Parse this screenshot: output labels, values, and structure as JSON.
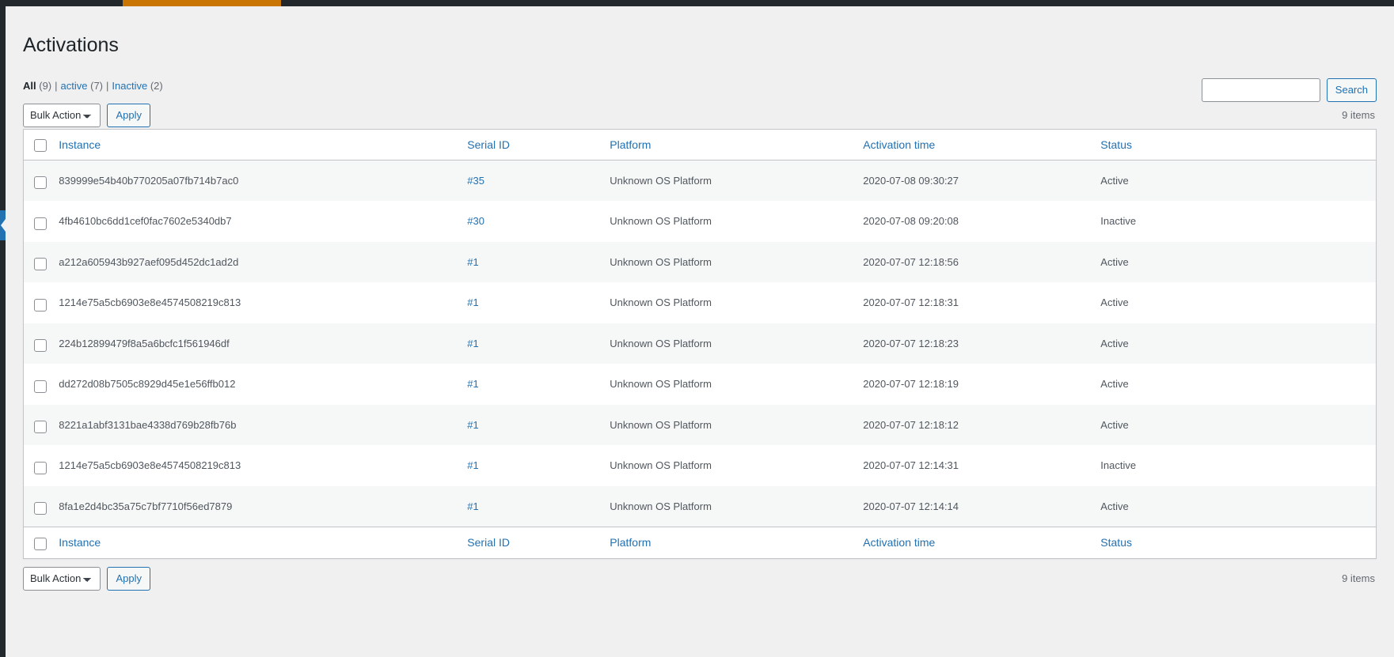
{
  "theme": {
    "adminbar_bg": "#23282d",
    "adminbar_accent": "#c87503",
    "link_color": "#2271b1",
    "text_color": "#50575e",
    "page_bg": "#f0f0f1",
    "row_alt_bg": "#f6f7f7"
  },
  "header": {
    "title": "Activations"
  },
  "views": {
    "all": {
      "label": "All",
      "count": "(9)"
    },
    "active": {
      "label": "active",
      "count": "(7)"
    },
    "inactive": {
      "label": "Inactive",
      "count": "(2)"
    },
    "separator": "|"
  },
  "search": {
    "value": "",
    "placeholder": "",
    "button_label": "Search"
  },
  "tablenav_top": {
    "bulk_selected": "Bulk Actions",
    "bulk_options": [
      "Bulk Actions"
    ],
    "apply_label": "Apply",
    "displaying_num": "9 items"
  },
  "tablenav_bottom": {
    "bulk_selected": "Bulk Actions",
    "bulk_options": [
      "Bulk Actions"
    ],
    "apply_label": "Apply",
    "displaying_num": "9 items"
  },
  "table": {
    "columns": {
      "instance": "Instance",
      "serial": "Serial ID",
      "platform": "Platform",
      "time": "Activation time",
      "status": "Status"
    },
    "rows": [
      {
        "instance": "839999e54b40b770205a07fb714b7ac0",
        "serial": "#35",
        "platform": "Unknown OS Platform",
        "time": "2020-07-08 09:30:27",
        "status": "Active"
      },
      {
        "instance": "4fb4610bc6dd1cef0fac7602e5340db7",
        "serial": "#30",
        "platform": "Unknown OS Platform",
        "time": "2020-07-08 09:20:08",
        "status": "Inactive"
      },
      {
        "instance": "a212a605943b927aef095d452dc1ad2d",
        "serial": "#1",
        "platform": "Unknown OS Platform",
        "time": "2020-07-07 12:18:56",
        "status": "Active"
      },
      {
        "instance": "1214e75a5cb6903e8e4574508219c813",
        "serial": "#1",
        "platform": "Unknown OS Platform",
        "time": "2020-07-07 12:18:31",
        "status": "Active"
      },
      {
        "instance": "224b12899479f8a5a6bcfc1f561946df",
        "serial": "#1",
        "platform": "Unknown OS Platform",
        "time": "2020-07-07 12:18:23",
        "status": "Active"
      },
      {
        "instance": "dd272d08b7505c8929d45e1e56ffb012",
        "serial": "#1",
        "platform": "Unknown OS Platform",
        "time": "2020-07-07 12:18:19",
        "status": "Active"
      },
      {
        "instance": "8221a1abf3131bae4338d769b28fb76b",
        "serial": "#1",
        "platform": "Unknown OS Platform",
        "time": "2020-07-07 12:18:12",
        "status": "Active"
      },
      {
        "instance": "1214e75a5cb6903e8e4574508219c813",
        "serial": "#1",
        "platform": "Unknown OS Platform",
        "time": "2020-07-07 12:14:31",
        "status": "Inactive"
      },
      {
        "instance": "8fa1e2d4bc35a75c7bf7710f56ed7879",
        "serial": "#1",
        "platform": "Unknown OS Platform",
        "time": "2020-07-07 12:14:14",
        "status": "Active"
      }
    ]
  }
}
